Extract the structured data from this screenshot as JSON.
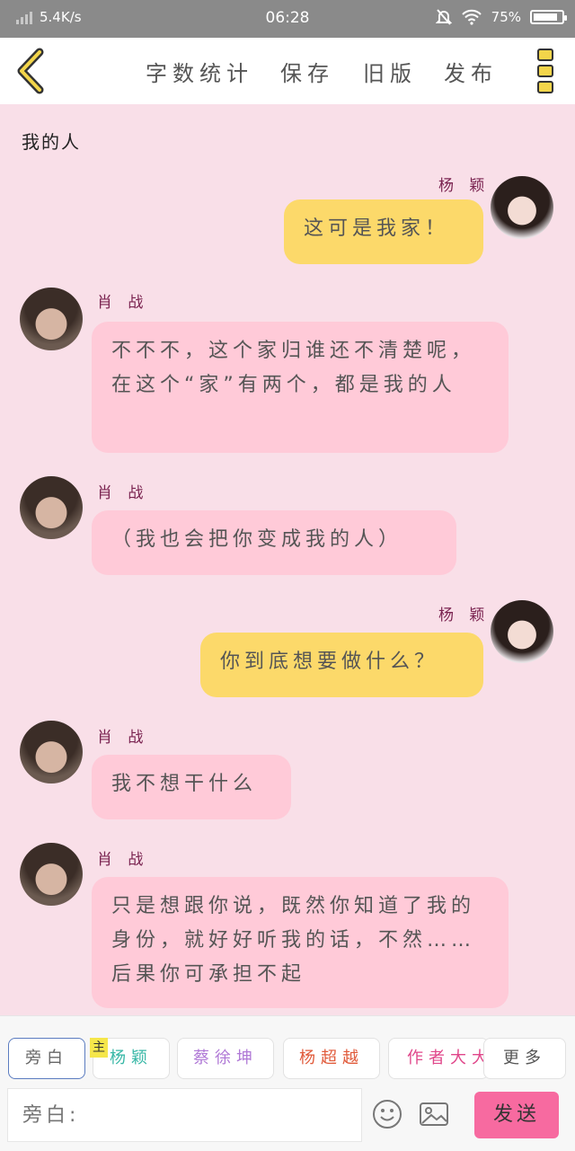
{
  "status_bar": {
    "speed": "5.4K/s",
    "time": "06:28",
    "battery": "75%"
  },
  "toolbar": {
    "buttons": [
      "字数统计",
      "保存",
      "旧版",
      "发布"
    ]
  },
  "chat": {
    "title": "我的人",
    "messages": [
      {
        "side": "right",
        "name": "杨 颖",
        "text": "这可是我家！"
      },
      {
        "side": "left",
        "name": "肖 战",
        "text": "不不不，这个家归谁还不清楚呢，在这个“家”有两个，都是我的人"
      },
      {
        "side": "left",
        "name": "肖 战",
        "text": "（我也会把你变成我的人）"
      },
      {
        "side": "right",
        "name": "杨 颖",
        "text": "你到底想要做什么？"
      },
      {
        "side": "left",
        "name": "肖 战",
        "text": "我不想干什么"
      },
      {
        "side": "left",
        "name": "肖 战",
        "text": "只是想跟你说，既然你知道了我的身份，就好好听我的话，不然……后果你可承担不起"
      }
    ]
  },
  "composer": {
    "role_chips": [
      {
        "label": "旁白",
        "color": "#666666"
      },
      {
        "label": "杨颖",
        "color": "#37b7a6"
      },
      {
        "label": "蔡徐坤",
        "color": "#b079d6"
      },
      {
        "label": "杨超越",
        "color": "#e05a3a"
      },
      {
        "label": "作者大大",
        "color": "#e0468a"
      }
    ],
    "main_tag": "主",
    "more_label": "更多",
    "placeholder": "旁白:",
    "send_label": "发送",
    "icons": [
      "emoji-icon",
      "image-icon"
    ]
  },
  "colors": {
    "background": "#f9dfe8",
    "left_bubble": "#ffcad8",
    "right_bubble": "#fcd96a",
    "name_color": "#7a2350",
    "send_button": "#f76aa0"
  }
}
